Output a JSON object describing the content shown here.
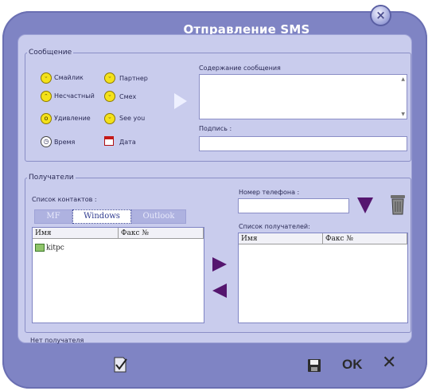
{
  "window": {
    "title": "Отправление SMS"
  },
  "message_group": {
    "legend": "Сообщение",
    "emoticons": [
      {
        "label": "Смайлик",
        "icon": "smile-icon"
      },
      {
        "label": "Партнер",
        "icon": "partner-icon"
      },
      {
        "label": "Несчастный",
        "icon": "sad-icon"
      },
      {
        "label": "Смех",
        "icon": "laugh-icon"
      },
      {
        "label": "Удивление",
        "icon": "surprise-icon"
      },
      {
        "label": "See you",
        "icon": "see-you-icon"
      },
      {
        "label": "Время",
        "icon": "clock-icon"
      },
      {
        "label": "Дата",
        "icon": "calendar-icon"
      }
    ],
    "content_label": "Содержание сообщения",
    "content_value": "",
    "signature_label": "Подпись :",
    "signature_value": ""
  },
  "recipients_group": {
    "legend": "Получатели",
    "contacts_label": "Список контактов :",
    "tabs": [
      "MF",
      "Windows",
      "Outlook"
    ],
    "active_tab": "Windows",
    "contacts_columns": [
      "Имя",
      "Факс №"
    ],
    "contacts": [
      {
        "name": "kitpc",
        "fax": ""
      }
    ],
    "phone_label": "Номер телефона :",
    "phone_value": "",
    "recipients_label": "Список получателей:",
    "recipients_columns": [
      "Имя",
      "Факс №"
    ],
    "recipients": [],
    "status": "Нет получателя"
  },
  "bottom": {
    "ok_label": "OK",
    "cancel_symbol": "✕"
  }
}
